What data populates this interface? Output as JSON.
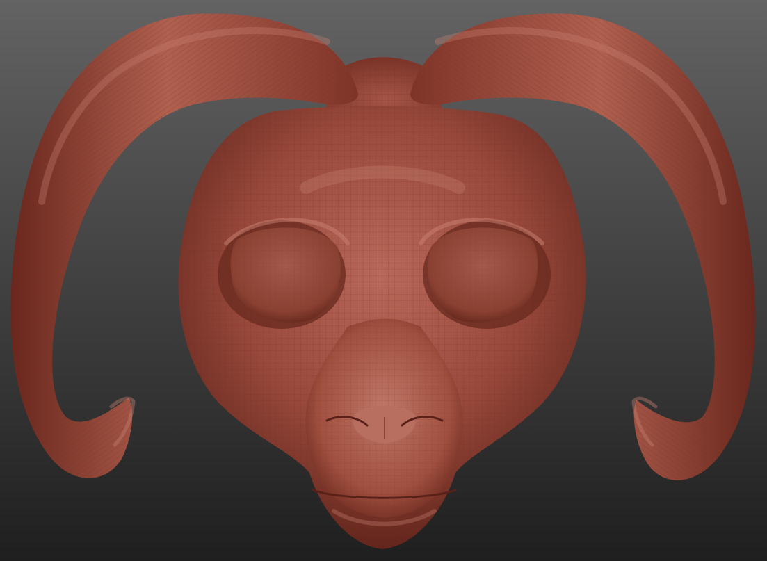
{
  "scene": {
    "background_top": "#636363",
    "background_bottom": "#1f1f1f",
    "material_base": "#9a4a3c",
    "material_light": "#c97d6c",
    "material_shadow": "#5a2119",
    "wire_color": "#6e2c22",
    "subject": "ram-mask-sculpt"
  }
}
